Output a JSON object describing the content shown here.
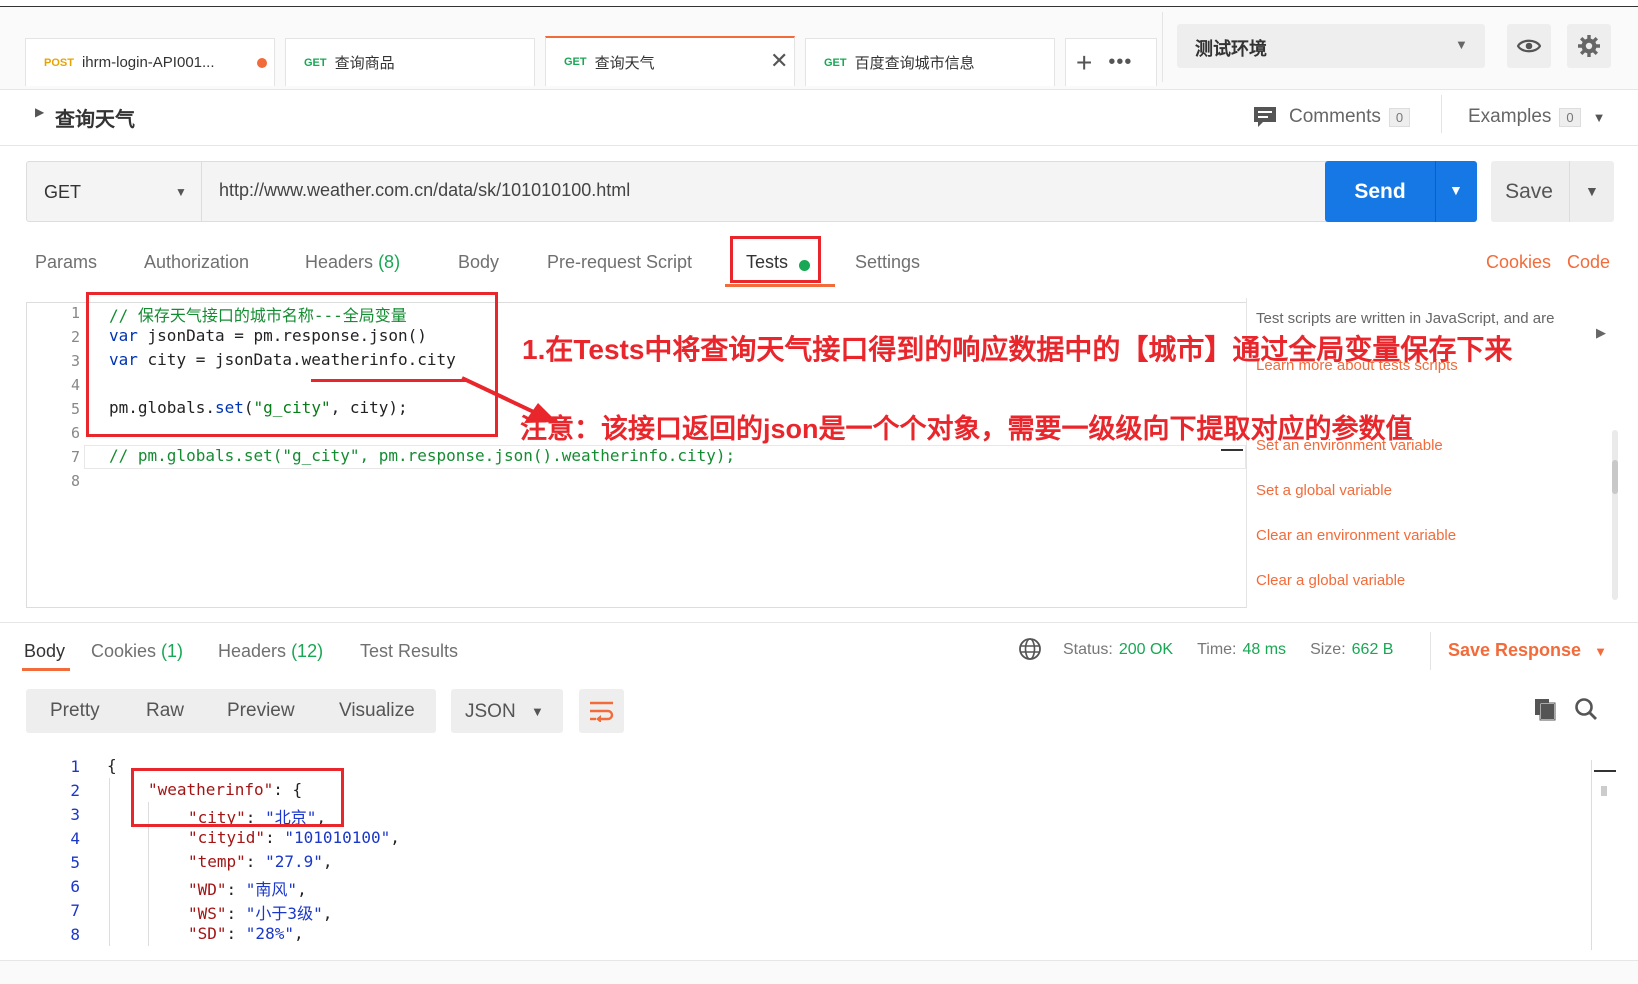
{
  "tabs": [
    {
      "method": "POST",
      "name": "ihrm-login-API001..."
    },
    {
      "method": "GET",
      "name": "查询商品"
    },
    {
      "method": "GET",
      "name": "查询天气"
    },
    {
      "method": "GET",
      "name": "百度查询城市信息"
    }
  ],
  "environment": {
    "selected": "测试环境"
  },
  "request": {
    "name": "查询天气",
    "method": "GET",
    "url": "http://www.weather.com.cn/data/sk/101010100.html",
    "send_label": "Send",
    "save_label": "Save",
    "comments_label": "Comments",
    "comments_count": "0",
    "examples_label": "Examples",
    "examples_count": "0"
  },
  "request_tabs": {
    "params": "Params",
    "authorization": "Authorization",
    "headers": "Headers",
    "headers_count": "(8)",
    "body": "Body",
    "prerequest": "Pre-request Script",
    "tests": "Tests",
    "settings": "Settings",
    "cookies": "Cookies",
    "code": "Code"
  },
  "editor": {
    "line_numbers": [
      "1",
      "2",
      "3",
      "4",
      "5",
      "6",
      "7",
      "8"
    ],
    "lines": {
      "l1": "// 保存天气接口的城市名称---全局变量",
      "l2_kw": "var",
      "l2_rest": " jsonData = pm.response.json()",
      "l3_kw": "var",
      "l3_rest": " city = jsonData.weatherinfo.city",
      "l5_a": "pm.globals.",
      "l5_fn": "set",
      "l5_b": "(",
      "l5_str": "\"g_city\"",
      "l5_c": ", city);",
      "l7": "// pm.globals.set(\"g_city\", pm.response.json().weatherinfo.city);"
    }
  },
  "snippets": {
    "description": "Test scripts are written in JavaScript, and are",
    "learn_more": "Learn more about tests scripts",
    "items": [
      "Set an environment variable",
      "Set a global variable",
      "Clear an environment variable",
      "Clear a global variable"
    ]
  },
  "annotations": {
    "main": "1.在Tests中将查询天气接口得到的响应数据中的【城市】通过全局变量保存下来",
    "note": "注意：该接口返回的json是一个个对象，需要一级级向下提取对应的参数值"
  },
  "response_tabs": {
    "body": "Body",
    "cookies": "Cookies",
    "cookies_count": "(1)",
    "headers": "Headers",
    "headers_count": "(12)",
    "test_results": "Test Results"
  },
  "status": {
    "status_label": "Status:",
    "status_value": "200 OK",
    "time_label": "Time:",
    "time_value": "48 ms",
    "size_label": "Size:",
    "size_value": "662 B",
    "save_response": "Save Response"
  },
  "view_modes": {
    "pretty": "Pretty",
    "raw": "Raw",
    "preview": "Preview",
    "visualize": "Visualize",
    "format": "JSON"
  },
  "response_json": {
    "line_numbers": [
      "1",
      "2",
      "3",
      "4",
      "5",
      "6",
      "7",
      "8"
    ],
    "l1": "{",
    "l2_key": "\"weatherinfo\"",
    "l2_rest": ": {",
    "l3_key": "\"city\"",
    "l3_val": "\"北京\"",
    "l4_key": "\"cityid\"",
    "l4_val": "\"101010100\"",
    "l5_key": "\"temp\"",
    "l5_val": "\"27.9\"",
    "l6_key": "\"WD\"",
    "l6_val": "\"南风\"",
    "l7_key": "\"WS\"",
    "l7_val": "\"小于3级\"",
    "l8_key": "\"SD\"",
    "l8_val": "\"28%\""
  },
  "colors": {
    "accent": "#f26b3a",
    "send": "#1678e5",
    "success": "#18a754",
    "annotation": "#e8262b"
  }
}
